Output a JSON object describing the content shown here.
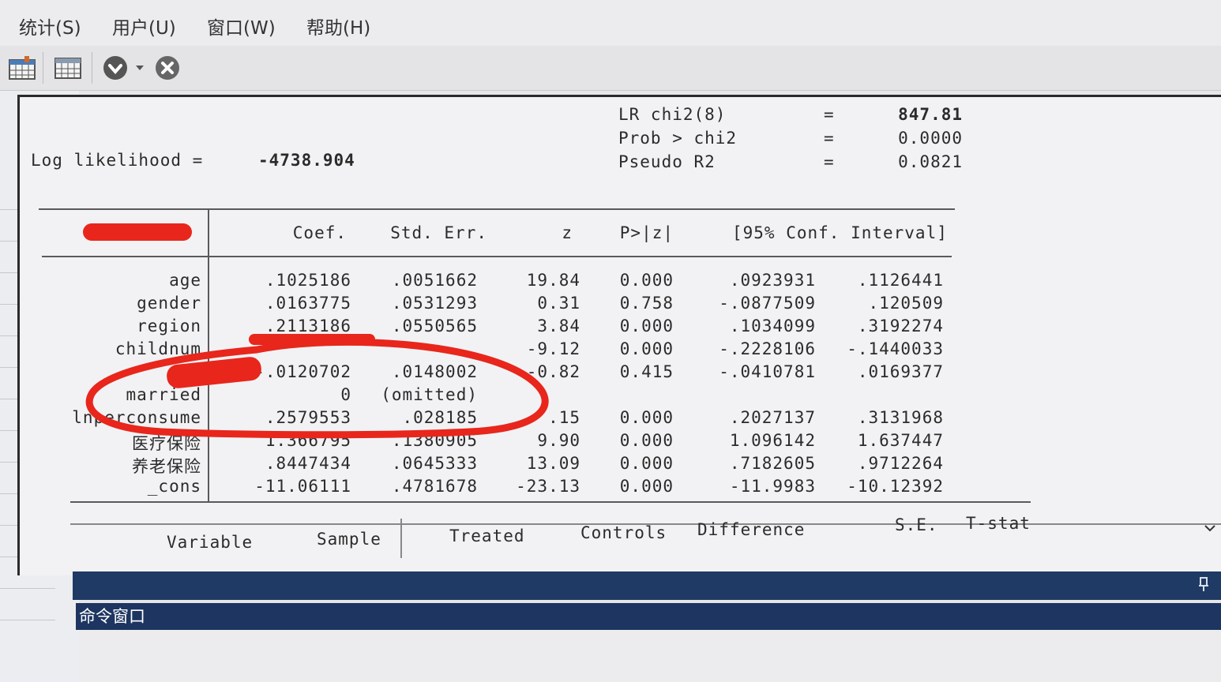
{
  "menu": [
    "统计(S)",
    "用户(U)",
    "窗口(W)",
    "帮助(H)"
  ],
  "toolbar_icons": [
    "data-editor-icon",
    "data-browser-icon",
    "down-circle-icon",
    "dropdown-arrow-icon",
    "break-icon"
  ],
  "header": {
    "log_likelihood_label": "Log likelihood =",
    "log_likelihood_value": "-4738.904",
    "stats": [
      {
        "label": "LR chi2(8)",
        "eq": "=",
        "value": "847.81"
      },
      {
        "label": "Prob > chi2",
        "eq": "=",
        "value": "0.0000"
      },
      {
        "label": "Pseudo R2",
        "eq": "=",
        "value": "0.0821"
      }
    ]
  },
  "table": {
    "columns": [
      "Coef.",
      "Std. Err.",
      "z",
      "P>|z|",
      "[95% Conf. Interval]"
    ],
    "rows": [
      {
        "var": "age",
        "coef": ".1025186",
        "se": ".0051662",
        "z": "19.84",
        "p": "0.000",
        "lo": ".0923931",
        "hi": ".1126441"
      },
      {
        "var": "gender",
        "coef": ".0163775",
        "se": ".0531293",
        "z": "0.31",
        "p": "0.758",
        "lo": "-.0877509",
        "hi": ".120509"
      },
      {
        "var": "region",
        "coef": ".2113186",
        "se": ".0550565",
        "z": "3.84",
        "p": "0.000",
        "lo": ".1034099",
        "hi": ".3192274"
      },
      {
        "var": "childnum",
        "coef": "",
        "se": "",
        "z": "-9.12",
        "p": "0.000",
        "lo": "-.2228106",
        "hi": "-.1440033"
      },
      {
        "var": "",
        "coef": "-.0120702",
        "se": ".0148002",
        "z": "-0.82",
        "p": "0.415",
        "lo": "-.0410781",
        "hi": ".0169377"
      },
      {
        "var": "married",
        "coef": "0",
        "se": "(omitted)",
        "z": "",
        "p": "",
        "lo": "",
        "hi": ""
      },
      {
        "var": "lnperconsume",
        "coef": ".2579553",
        "se": ".028185",
        "z": ".15",
        "p": "0.000",
        "lo": ".2027137",
        "hi": ".3131968"
      },
      {
        "var": "医疗保险",
        "coef": "1.366795",
        "se": ".1380905",
        "z": "9.90",
        "p": "0.000",
        "lo": "1.096142",
        "hi": "1.637447"
      },
      {
        "var": "养老保险",
        "coef": ".8447434",
        "se": ".0645333",
        "z": "13.09",
        "p": "0.000",
        "lo": ".7182605",
        "hi": ".9712264"
      },
      {
        "var": "_cons",
        "coef": "-11.06111",
        "se": ".4781678",
        "z": "-23.13",
        "p": "0.000",
        "lo": "-11.9983",
        "hi": "-10.12392"
      }
    ]
  },
  "second_table": {
    "columns": [
      "Variable",
      "Sample",
      "Treated",
      "Controls",
      "Difference",
      "S.E.",
      "T-stat"
    ]
  },
  "command_window": {
    "title": "命令窗口"
  },
  "colors": {
    "annotation_red": "#e8261c",
    "command_bar": "#1f3a64"
  }
}
